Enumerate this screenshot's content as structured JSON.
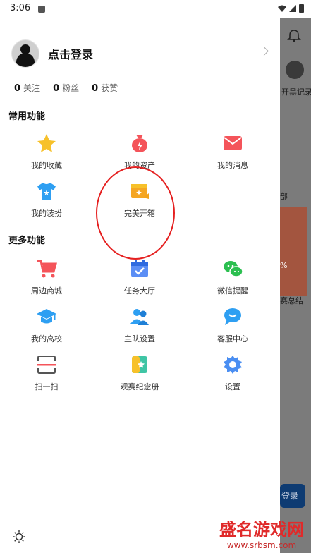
{
  "status_bar": {
    "time": "3:06"
  },
  "background_app": {
    "snippet_1": "开黑记录",
    "snippet_2": "部",
    "snippet_3": "%",
    "snippet_4": "赛总结",
    "button_label": "登录"
  },
  "drawer": {
    "login_label": "点击登录",
    "stats": [
      {
        "count": "0",
        "label": "关注"
      },
      {
        "count": "0",
        "label": "粉丝"
      },
      {
        "count": "0",
        "label": "获赞"
      }
    ],
    "common_title": "常用功能",
    "common_items": [
      {
        "label": "我的收藏",
        "icon": "star-icon"
      },
      {
        "label": "我的资产",
        "icon": "money-bag-icon"
      },
      {
        "label": "我的消息",
        "icon": "mail-icon"
      },
      {
        "label": "我的装扮",
        "icon": "tshirt-icon"
      },
      {
        "label": "完美开箱",
        "icon": "gift-box-icon"
      }
    ],
    "more_title": "更多功能",
    "more_items": [
      {
        "label": "周边商城",
        "icon": "shopping-cart-icon"
      },
      {
        "label": "任务大厅",
        "icon": "calendar-check-icon"
      },
      {
        "label": "微信提醒",
        "icon": "wechat-icon"
      },
      {
        "label": "我的高校",
        "icon": "graduation-cap-icon"
      },
      {
        "label": "主队设置",
        "icon": "team-icon"
      },
      {
        "label": "客服中心",
        "icon": "chat-bubble-icon"
      },
      {
        "label": "扫一扫",
        "icon": "scan-icon"
      },
      {
        "label": "观赛纪念册",
        "icon": "album-icon"
      },
      {
        "label": "设置",
        "icon": "gear-icon"
      }
    ]
  },
  "watermark": {
    "title": "盛名游戏网",
    "url": "www.srbsm.com"
  },
  "colors": {
    "annotation_circle": "#e52020",
    "accent_red": "#f4545a",
    "accent_blue": "#2e9ff2"
  }
}
